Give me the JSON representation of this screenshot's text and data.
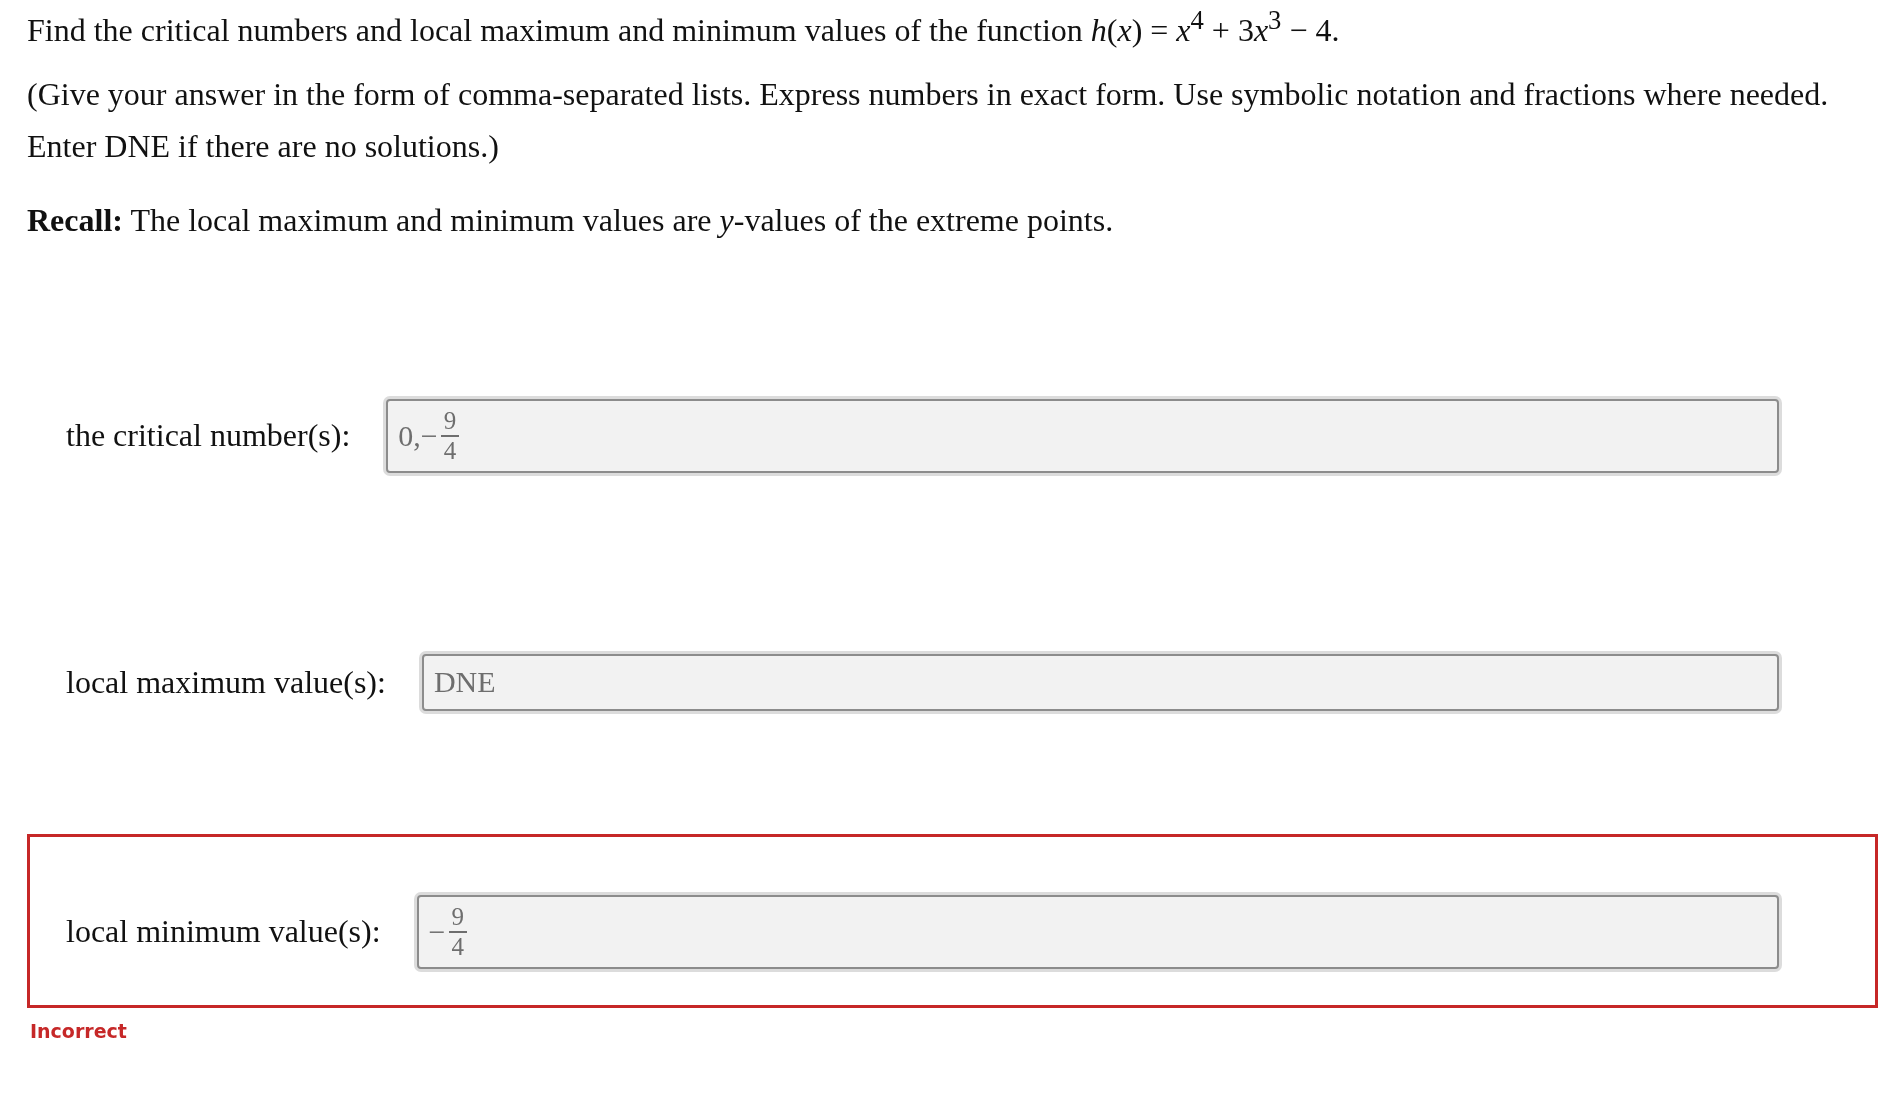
{
  "question": {
    "prompt": [
      "Find the critical numbers and local maximum and minimum values of the function *h*(*x*) = *x*$^{4}$ + 3",
      "*x*$^{3}$ − 4."
    ],
    "instructions": "(Give your answer in the form of comma-separated lists. Express numbers in exact form. Use symbolic notation and fractions where needed. Enter DNE if there are no solutions.)",
    "recall": "**Recall:** The local maximum and minimum values are *y*-values of the extreme points."
  },
  "answers": [
    {
      "label": "the critical number(s):",
      "value": [
        {
          "kind": "text",
          "text": "0,−"
        },
        {
          "kind": "fraction",
          "numerator": "9",
          "denominator": "4"
        }
      ],
      "incorrect": false
    },
    {
      "label": "local maximum value(s):",
      "value": [
        {
          "kind": "text",
          "text": "DNE"
        }
      ],
      "incorrect": false
    },
    {
      "label": "local minimum value(s):",
      "value": [
        {
          "kind": "text",
          "text": "−"
        },
        {
          "kind": "fraction",
          "numerator": "9",
          "denominator": "4"
        }
      ],
      "incorrect": true,
      "feedback": "Incorrect"
    }
  ]
}
